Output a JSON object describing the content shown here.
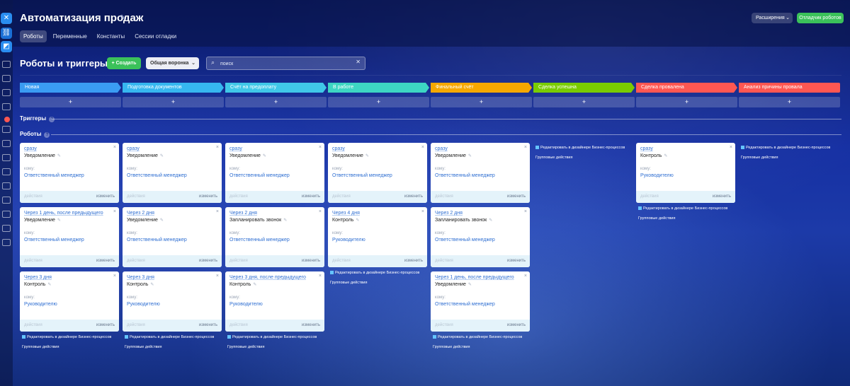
{
  "header": {
    "title": "Автоматизация продаж",
    "tabs": [
      {
        "label": "Роботы",
        "active": true
      },
      {
        "label": "Переменные",
        "active": false
      },
      {
        "label": "Константы",
        "active": false
      },
      {
        "label": "Сессии отладки",
        "active": false
      }
    ],
    "extensions_label": "Расширения",
    "debug_label": "Отладчик роботов"
  },
  "toolbar": {
    "title": "Роботы и триггеры",
    "create_label": "Создать",
    "funnel_label": "Общая воронка",
    "search_placeholder": "поиск"
  },
  "stages": [
    {
      "name": "Новая",
      "color": "#3a9cf3"
    },
    {
      "name": "Подготовка документов",
      "color": "#36b7f0"
    },
    {
      "name": "Счёт на предоплату",
      "color": "#40c8e8"
    },
    {
      "name": "В работе",
      "color": "#3dd6c3"
    },
    {
      "name": "Финальный счёт",
      "color": "#f6a800"
    },
    {
      "name": "Сделка успешна",
      "color": "#7acc00"
    },
    {
      "name": "Сделка провалена",
      "color": "#ff5752"
    },
    {
      "name": "Анализ причины провала",
      "color": "#ff5752"
    }
  ],
  "add_symbol": "+",
  "sections": {
    "triggers": "Триггеры",
    "robots": "Роботы",
    "help_symbol": "?"
  },
  "card_labels": {
    "to": "кому:",
    "actions": "действия",
    "edit": "изменить",
    "close": "×"
  },
  "links": {
    "bp_designer": "Редактировать в дизайнере Бизнес-процессов",
    "group_actions": "Групповые действия"
  },
  "columns": [
    {
      "cards": [
        {
          "delay": "сразу",
          "robot": "Уведомление",
          "target": "Ответственный менеджер"
        },
        {
          "delay": "Через 1 день, после предыдущего",
          "robot": "Уведомление",
          "target": "Ответственный менеджер"
        },
        {
          "delay": "Через 3 дня",
          "robot": "Контроль",
          "target": "Руководителю"
        }
      ]
    },
    {
      "cards": [
        {
          "delay": "сразу",
          "robot": "Уведомление",
          "target": "Ответственный менеджер"
        },
        {
          "delay": "Через 2 дня",
          "robot": "Уведомление",
          "target": "Ответственный менеджер"
        },
        {
          "delay": "Через 3 дня",
          "robot": "Контроль",
          "target": "Руководителю"
        }
      ]
    },
    {
      "cards": [
        {
          "delay": "сразу",
          "robot": "Уведомление",
          "target": "Ответственный менеджер"
        },
        {
          "delay": "Через 2 дня",
          "robot": "Запланировать звонок",
          "target": "Ответственный менеджер"
        },
        {
          "delay": "Через 3 дня, после предыдущего",
          "robot": "Контроль",
          "target": "Руководителю"
        }
      ]
    },
    {
      "cards": [
        {
          "delay": "сразу",
          "robot": "Уведомление",
          "target": "Ответственный менеджер"
        },
        {
          "delay": "Через 4 дня",
          "robot": "Контроль",
          "target": "Руководителю"
        }
      ]
    },
    {
      "cards": [
        {
          "delay": "сразу",
          "robot": "Уведомление",
          "target": "Ответственный менеджер"
        },
        {
          "delay": "Через 2 дня",
          "robot": "Запланировать звонок",
          "target": "Ответственный менеджер"
        },
        {
          "delay": "Через 1 день, после предыдущего",
          "robot": "Уведомление",
          "target": "Ответственный менеджер"
        }
      ]
    },
    {
      "cards": []
    },
    {
      "cards": [
        {
          "delay": "сразу",
          "robot": "Контроль",
          "target": "Руководителю"
        }
      ]
    },
    {
      "cards": []
    }
  ]
}
